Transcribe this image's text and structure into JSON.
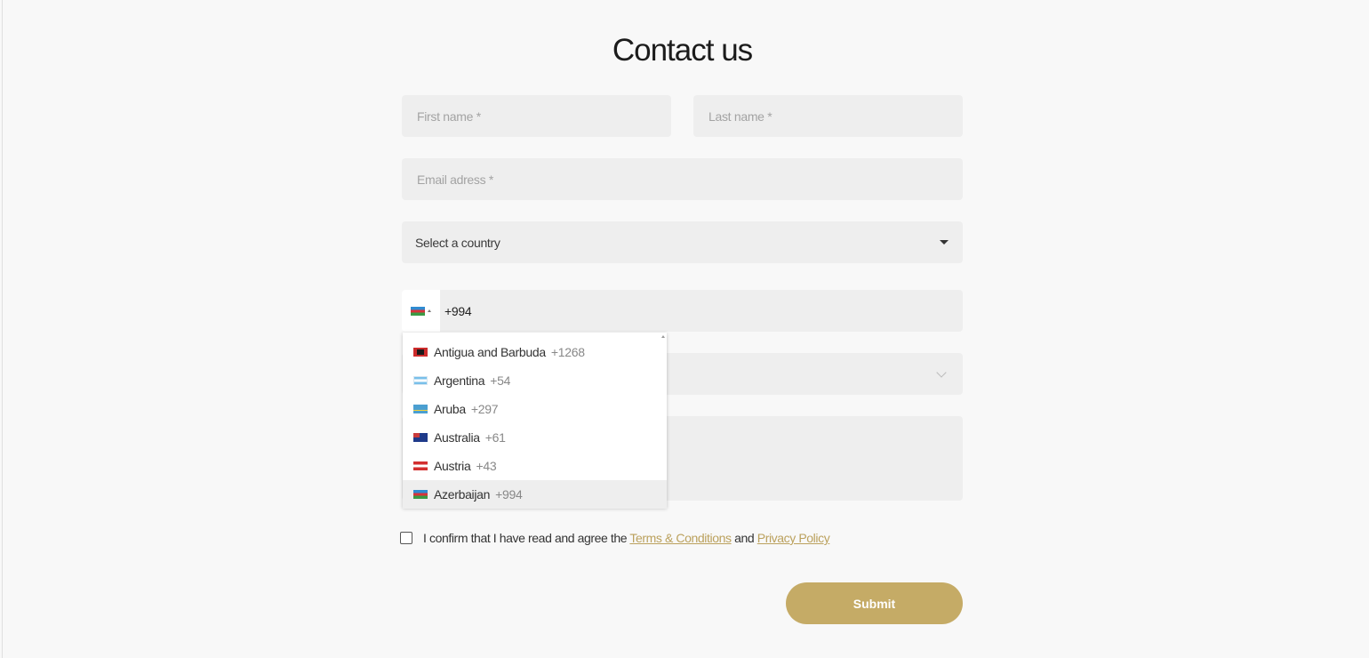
{
  "page": {
    "title": "Contact us"
  },
  "form": {
    "first_name_placeholder": "First name *",
    "last_name_placeholder": "Last name *",
    "email_placeholder": "Email adress *",
    "country_select_label": "Select a country",
    "phone": {
      "flag": "az-flag-icon",
      "value": "+994"
    },
    "subject_value": "",
    "message_value": ""
  },
  "phone_dropdown": {
    "items": [
      {
        "name": "Antigua and Barbuda",
        "code": "+1268",
        "flag": "ag-flag-icon"
      },
      {
        "name": "Argentina",
        "code": "+54",
        "flag": "ar-flag-icon"
      },
      {
        "name": "Aruba",
        "code": "+297",
        "flag": "aw-flag-icon"
      },
      {
        "name": "Australia",
        "code": "+61",
        "flag": "au-flag-icon"
      },
      {
        "name": "Austria",
        "code": "+43",
        "flag": "at-flag-icon"
      },
      {
        "name": "Azerbaijan",
        "code": "+994",
        "flag": "az-flag-icon",
        "selected": true
      }
    ]
  },
  "consent": {
    "prefix": "I confirm that I have read and agree the",
    "terms_link": "Terms & Conditions",
    "and_text": "and",
    "privacy_link": "Privacy Policy"
  },
  "submit_label": "Submit",
  "colors": {
    "accent": "#c5ab66",
    "link": "#bba15d",
    "field_bg": "#eeeeee",
    "page_bg": "#f8f8f8"
  }
}
